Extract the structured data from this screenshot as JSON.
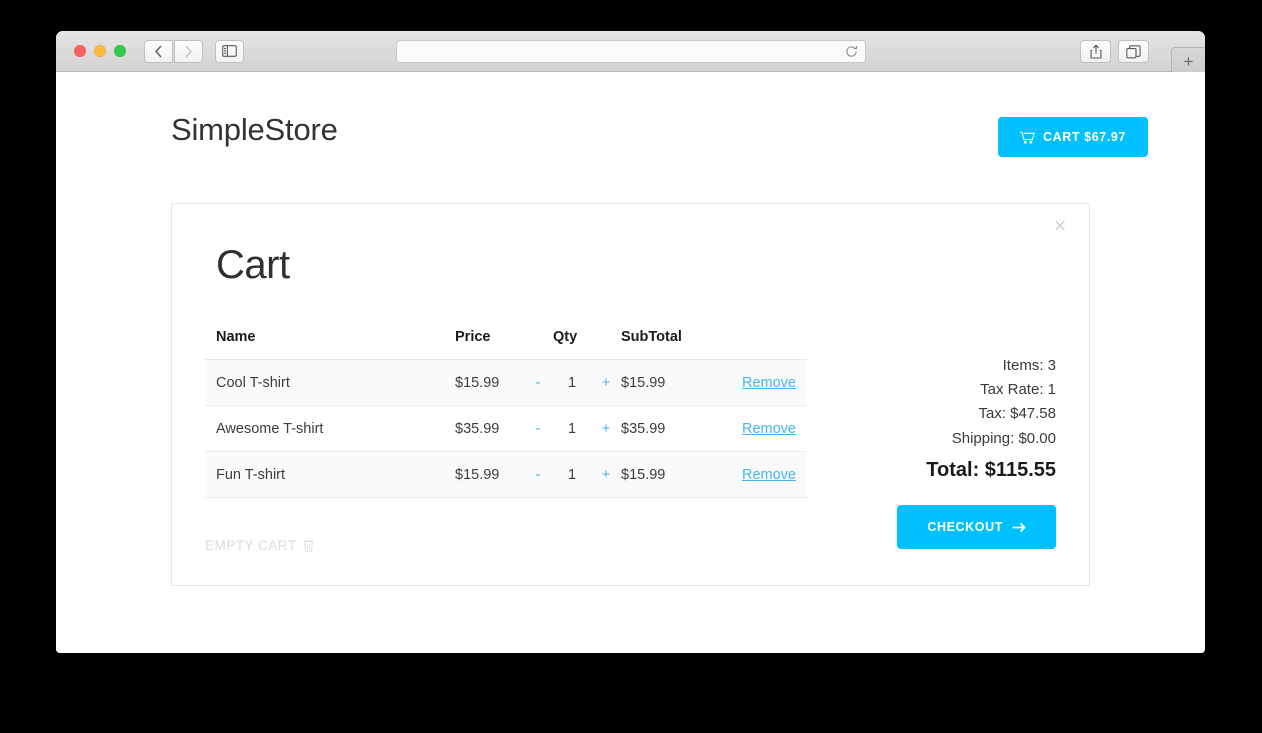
{
  "browser": {
    "address_value": "",
    "address_placeholder": "",
    "back_icon": "chevron-left-icon",
    "forward_icon": "chevron-right-icon",
    "sidebar_icon": "sidebar-icon",
    "reload_icon": "reload-icon",
    "share_icon": "share-icon",
    "tabs_icon": "tabs-icon",
    "newtab_label": "+"
  },
  "header": {
    "brand": "SimpleStore",
    "cart_button_label": "CART $67.97",
    "cart_icon": "shopping-cart-icon"
  },
  "cart": {
    "title": "Cart",
    "close_label": "×",
    "columns": [
      "Name",
      "Price",
      "Qty",
      "SubTotal"
    ],
    "rows": [
      {
        "name": "Cool T-shirt",
        "price": "$15.99",
        "minus": "-",
        "qty": "1",
        "plus": "+",
        "subtotal": "$15.99",
        "remove": "Remove"
      },
      {
        "name": "Awesome T-shirt",
        "price": "$35.99",
        "minus": "-",
        "qty": "1",
        "plus": "+",
        "subtotal": "$35.99",
        "remove": "Remove"
      },
      {
        "name": "Fun T-shirt",
        "price": "$15.99",
        "minus": "-",
        "qty": "1",
        "plus": "+",
        "subtotal": "$15.99",
        "remove": "Remove"
      }
    ],
    "empty_cart_label": "EMPTY CART",
    "empty_cart_icon": "trash-icon",
    "summary": {
      "items": "Items: 3",
      "tax_rate": "Tax Rate: 1",
      "tax": "Tax: $47.58",
      "shipping": "Shipping: $0.00",
      "total": "Total: $115.55"
    },
    "checkout_label": "CHECKOUT",
    "checkout_icon": "arrow-right-icon"
  },
  "colors": {
    "accent": "#00c0ff",
    "link": "#45b6ee",
    "muted": "#dcdcdc"
  }
}
